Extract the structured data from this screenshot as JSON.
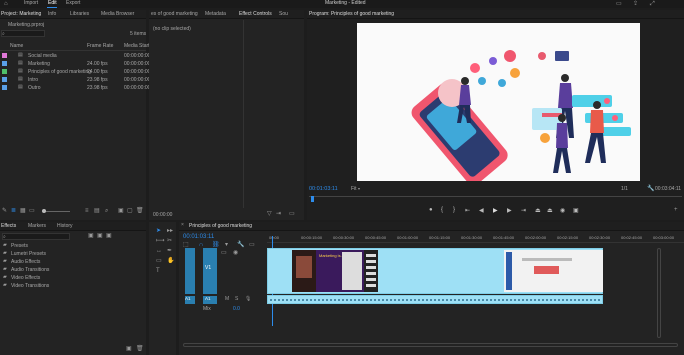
{
  "app": {
    "title": "Marketing - Edited",
    "menu": [
      "Import",
      "Edit",
      "Export"
    ],
    "active_menu": "Edit"
  },
  "project": {
    "tabs": [
      "Project: Marketing",
      "Info",
      "Libraries",
      "Media Browser"
    ],
    "file": "Marketing.prproj",
    "items_count": "5 items",
    "columns": [
      "Name",
      "Frame Rate",
      "Media Start"
    ],
    "items": [
      {
        "name": "Social media",
        "rate": "",
        "start": "00:00:00:00",
        "color": "#e078d8"
      },
      {
        "name": "Marketing",
        "rate": "24.00 fps",
        "start": "00:00:00:00",
        "color": "#5aa0e8"
      },
      {
        "name": "Principles of good marketing",
        "rate": "24.00 fps",
        "start": "00:00:00:00",
        "color": "#4fbf6a"
      },
      {
        "name": "Intro",
        "rate": "23.98 fps",
        "start": "00:00:00:00",
        "color": "#5aa0e8"
      },
      {
        "name": "Outro",
        "rate": "23.98 fps",
        "start": "00:00:00:00",
        "color": "#5aa0e8"
      }
    ]
  },
  "source": {
    "tabs": [
      "es of good marketing",
      "Metadata",
      "Effect Controls",
      "Sou"
    ],
    "active_tab": "Effect Controls",
    "no_clip": "(no clip selected)",
    "timecode": "00:00:00"
  },
  "program": {
    "title": "Program: Principles of good marketing",
    "timecode": "00:01:03:11",
    "fit": "Fit",
    "page": "1/1",
    "duration": "00:03:04:11"
  },
  "effects": {
    "tabs": [
      "Effects",
      "Markers",
      "History"
    ],
    "items": [
      "Presets",
      "Lumetri Presets",
      "Audio Effects",
      "Audio Transitions",
      "Video Effects",
      "Video Transitions"
    ]
  },
  "timeline": {
    "title": "Principles of good marketing",
    "timecode": "00:01:03:11",
    "ruler": [
      "00:00",
      "00:00:15:00",
      "00:00:30:00",
      "00:00:45:00",
      "00:01:00:00",
      "00:01:15:00",
      "00:01:30:00",
      "00:01:45:00",
      "00:02:00:00",
      "00:02:15:00",
      "00:02:30:00",
      "00:02:45:00",
      "00:03:00:00"
    ],
    "tracks": {
      "v1": "V1",
      "a1": "A1",
      "mix": "Mix",
      "mix_val": "0.0"
    },
    "clip_text": "Marketing is..."
  },
  "colors": {
    "accent": "#2d8ceb",
    "clip_video": "#9ee0f5",
    "track_label": "#2a7fb0"
  }
}
